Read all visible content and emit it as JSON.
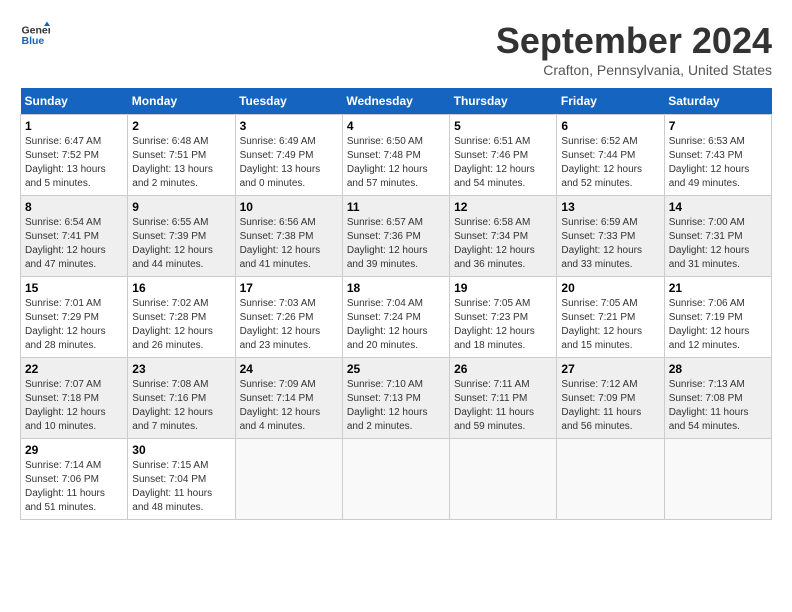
{
  "header": {
    "logo_line1": "General",
    "logo_line2": "Blue",
    "month_year": "September 2024",
    "location": "Crafton, Pennsylvania, United States"
  },
  "weekdays": [
    "Sunday",
    "Monday",
    "Tuesday",
    "Wednesday",
    "Thursday",
    "Friday",
    "Saturday"
  ],
  "weeks": [
    [
      {
        "day": "1",
        "sunrise": "6:47 AM",
        "sunset": "7:52 PM",
        "daylight": "13 hours and 5 minutes."
      },
      {
        "day": "2",
        "sunrise": "6:48 AM",
        "sunset": "7:51 PM",
        "daylight": "13 hours and 2 minutes."
      },
      {
        "day": "3",
        "sunrise": "6:49 AM",
        "sunset": "7:49 PM",
        "daylight": "13 hours and 0 minutes."
      },
      {
        "day": "4",
        "sunrise": "6:50 AM",
        "sunset": "7:48 PM",
        "daylight": "12 hours and 57 minutes."
      },
      {
        "day": "5",
        "sunrise": "6:51 AM",
        "sunset": "7:46 PM",
        "daylight": "12 hours and 54 minutes."
      },
      {
        "day": "6",
        "sunrise": "6:52 AM",
        "sunset": "7:44 PM",
        "daylight": "12 hours and 52 minutes."
      },
      {
        "day": "7",
        "sunrise": "6:53 AM",
        "sunset": "7:43 PM",
        "daylight": "12 hours and 49 minutes."
      }
    ],
    [
      {
        "day": "8",
        "sunrise": "6:54 AM",
        "sunset": "7:41 PM",
        "daylight": "12 hours and 47 minutes."
      },
      {
        "day": "9",
        "sunrise": "6:55 AM",
        "sunset": "7:39 PM",
        "daylight": "12 hours and 44 minutes."
      },
      {
        "day": "10",
        "sunrise": "6:56 AM",
        "sunset": "7:38 PM",
        "daylight": "12 hours and 41 minutes."
      },
      {
        "day": "11",
        "sunrise": "6:57 AM",
        "sunset": "7:36 PM",
        "daylight": "12 hours and 39 minutes."
      },
      {
        "day": "12",
        "sunrise": "6:58 AM",
        "sunset": "7:34 PM",
        "daylight": "12 hours and 36 minutes."
      },
      {
        "day": "13",
        "sunrise": "6:59 AM",
        "sunset": "7:33 PM",
        "daylight": "12 hours and 33 minutes."
      },
      {
        "day": "14",
        "sunrise": "7:00 AM",
        "sunset": "7:31 PM",
        "daylight": "12 hours and 31 minutes."
      }
    ],
    [
      {
        "day": "15",
        "sunrise": "7:01 AM",
        "sunset": "7:29 PM",
        "daylight": "12 hours and 28 minutes."
      },
      {
        "day": "16",
        "sunrise": "7:02 AM",
        "sunset": "7:28 PM",
        "daylight": "12 hours and 26 minutes."
      },
      {
        "day": "17",
        "sunrise": "7:03 AM",
        "sunset": "7:26 PM",
        "daylight": "12 hours and 23 minutes."
      },
      {
        "day": "18",
        "sunrise": "7:04 AM",
        "sunset": "7:24 PM",
        "daylight": "12 hours and 20 minutes."
      },
      {
        "day": "19",
        "sunrise": "7:05 AM",
        "sunset": "7:23 PM",
        "daylight": "12 hours and 18 minutes."
      },
      {
        "day": "20",
        "sunrise": "7:05 AM",
        "sunset": "7:21 PM",
        "daylight": "12 hours and 15 minutes."
      },
      {
        "day": "21",
        "sunrise": "7:06 AM",
        "sunset": "7:19 PM",
        "daylight": "12 hours and 12 minutes."
      }
    ],
    [
      {
        "day": "22",
        "sunrise": "7:07 AM",
        "sunset": "7:18 PM",
        "daylight": "12 hours and 10 minutes."
      },
      {
        "day": "23",
        "sunrise": "7:08 AM",
        "sunset": "7:16 PM",
        "daylight": "12 hours and 7 minutes."
      },
      {
        "day": "24",
        "sunrise": "7:09 AM",
        "sunset": "7:14 PM",
        "daylight": "12 hours and 4 minutes."
      },
      {
        "day": "25",
        "sunrise": "7:10 AM",
        "sunset": "7:13 PM",
        "daylight": "12 hours and 2 minutes."
      },
      {
        "day": "26",
        "sunrise": "7:11 AM",
        "sunset": "7:11 PM",
        "daylight": "11 hours and 59 minutes."
      },
      {
        "day": "27",
        "sunrise": "7:12 AM",
        "sunset": "7:09 PM",
        "daylight": "11 hours and 56 minutes."
      },
      {
        "day": "28",
        "sunrise": "7:13 AM",
        "sunset": "7:08 PM",
        "daylight": "11 hours and 54 minutes."
      }
    ],
    [
      {
        "day": "29",
        "sunrise": "7:14 AM",
        "sunset": "7:06 PM",
        "daylight": "11 hours and 51 minutes."
      },
      {
        "day": "30",
        "sunrise": "7:15 AM",
        "sunset": "7:04 PM",
        "daylight": "11 hours and 48 minutes."
      },
      null,
      null,
      null,
      null,
      null
    ]
  ]
}
